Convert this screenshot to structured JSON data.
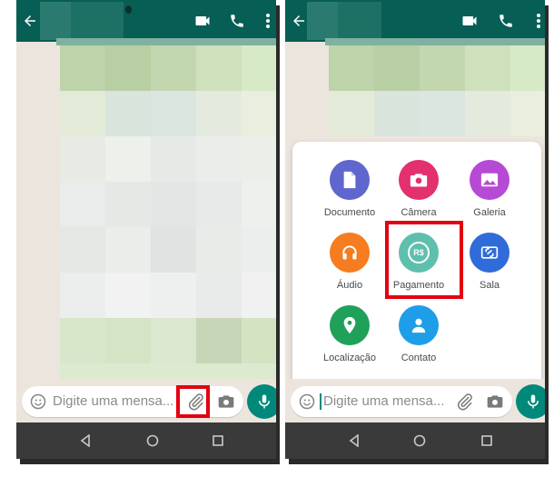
{
  "left": {
    "input_placeholder": "Digite uma mensa..."
  },
  "right": {
    "input_placeholder": "Digite uma mensa...",
    "attachments": [
      {
        "label": "Documento",
        "icon": "document-icon",
        "color": "#5f66cd"
      },
      {
        "label": "Câmera",
        "icon": "camera-icon",
        "color": "#e3306e"
      },
      {
        "label": "Galeria",
        "icon": "gallery-icon",
        "color": "#b64ad5"
      },
      {
        "label": "Áudio",
        "icon": "headphones-icon",
        "color": "#f57c1f"
      },
      {
        "label": "Pagamento",
        "icon": "payment-icon",
        "symbol": "R$",
        "color": "#5fbfad"
      },
      {
        "label": "Sala",
        "icon": "room-icon",
        "color": "#2f6cd9"
      },
      {
        "label": "Localização",
        "icon": "location-icon",
        "color": "#1fa15a"
      },
      {
        "label": "Contato",
        "icon": "contact-icon",
        "color": "#1e9ee8"
      }
    ]
  },
  "colors": {
    "header": "#075e54",
    "mic": "#00897b",
    "highlight": "#e3000f",
    "navbar": "#3a3a3a"
  }
}
